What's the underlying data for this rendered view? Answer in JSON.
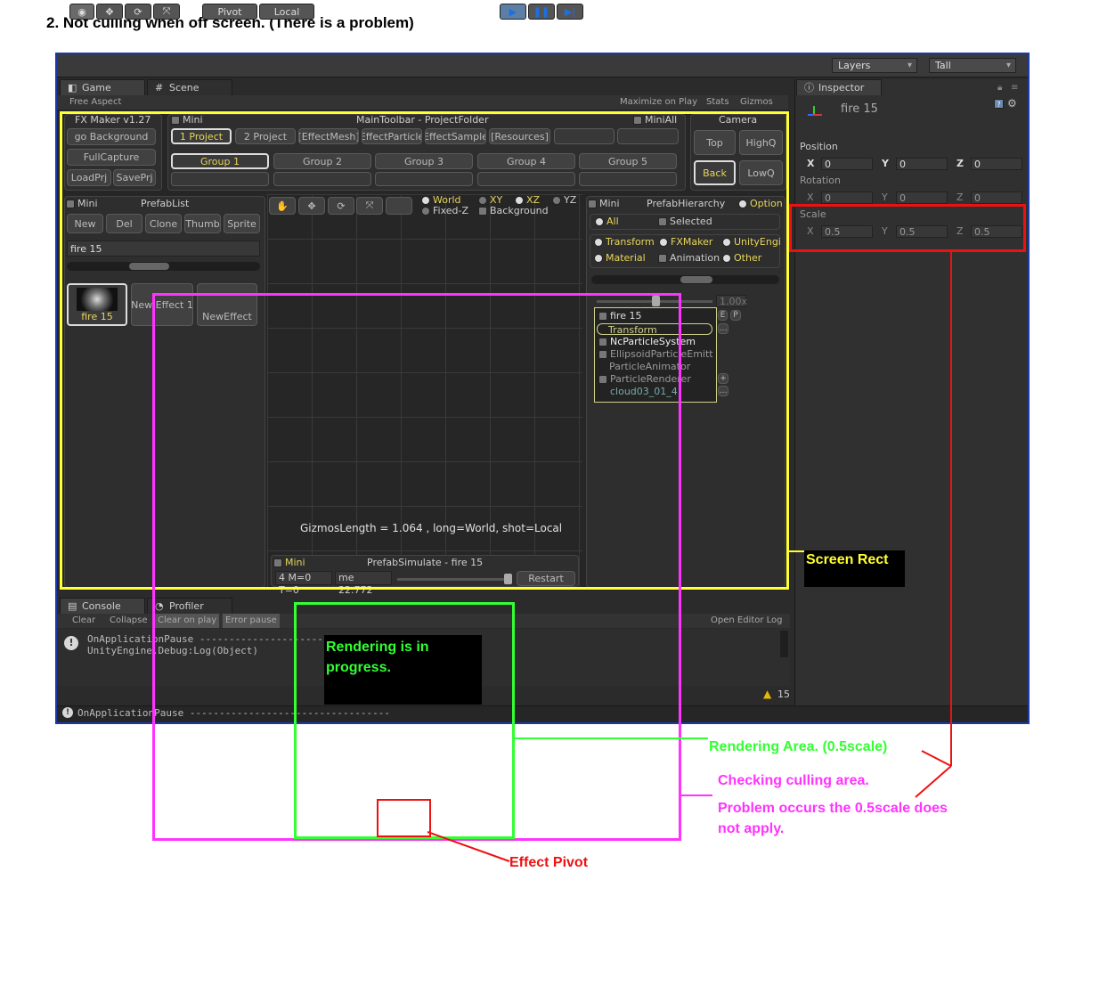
{
  "heading": "2. Not culling when off screen. (There is a problem)",
  "toolbar": {
    "pivot": "Pivot",
    "local": "Local",
    "layers": "Layers",
    "layout": "Tall"
  },
  "game_tab": {
    "game": "Game",
    "scene": "Scene",
    "aspect": "Free Aspect",
    "maximize": "Maximize on Play",
    "stats": "Stats",
    "gizmos": "Gizmos"
  },
  "fxmaker": {
    "version": "FX Maker v1.27",
    "go_background": "go Background",
    "full_capture": "FullCapture",
    "load_prj": "LoadPrj",
    "save_prj": "SavePrj",
    "mini": "Mini",
    "main_toolbar": "MainToolbar - ProjectFolder",
    "mini_all": "MiniAll",
    "projects": [
      "1 Project",
      "2 Project",
      "[EffectMesh]",
      "EffectParticle",
      "EffectSample",
      "[Resources]"
    ],
    "groups": [
      "Group 1",
      "Group 2",
      "Group 3",
      "Group 4",
      "Group 5"
    ],
    "camera": "Camera",
    "cam_top": "Top",
    "cam_highq": "HighQ",
    "cam_back": "Back",
    "cam_lowq": "LowQ"
  },
  "prefab_list": {
    "mini": "Mini",
    "title": "PrefabList",
    "buttons": [
      "New",
      "Del",
      "Clone",
      "Thumb",
      "Sprite"
    ],
    "search": "fire 15",
    "items": [
      "fire 15",
      "New Effect 1",
      "NewEffect"
    ]
  },
  "scene_tools": {
    "world": "World",
    "fixed_z": "Fixed-Z",
    "xy": "XY",
    "xz": "XZ",
    "yz": "YZ",
    "background": "Background",
    "gizmos_info": "GizmosLength = 1.064 , long=World, shot=Local"
  },
  "prefab_simulate": {
    "mini": "Mini",
    "title": "PrefabSimulate - fire 15",
    "stats": "4 M=0 T=0",
    "time": "me 22.772",
    "restart": "Restart"
  },
  "hierarchy": {
    "mini": "Mini",
    "title": "PrefabHierarchy",
    "option": "Option",
    "all": "All",
    "selected": "Selected",
    "filters": [
      "Transform",
      "FXMaker",
      "UnityEngi",
      "Material",
      "Animation",
      "Other"
    ],
    "speed": "1.00x",
    "nodes": [
      "fire 15",
      "Transform",
      "NcParticleSystem",
      "EllipsoidParticleEmitt",
      "ParticleAnimator",
      "ParticleRenderer",
      "cloud03_01_4"
    ]
  },
  "inspector": {
    "tab": "Inspector",
    "object": "fire 15",
    "position": "Position",
    "rotation": "Rotation",
    "scale": "Scale",
    "axes": [
      "X",
      "Y",
      "Z"
    ],
    "position_values": [
      "0",
      "0",
      "0"
    ],
    "rotation_values": [
      "0",
      "0",
      "0"
    ],
    "scale_values": [
      "0.5",
      "0.5",
      "0.5"
    ]
  },
  "console": {
    "tab": "Console",
    "profiler": "Profiler",
    "buttons": [
      "Clear",
      "Collapse",
      "Clear on play",
      "Error pause"
    ],
    "open_log": "Open Editor Log",
    "line1": "OnApplicationPause ----------------------------------",
    "line2": "UnityEngine.Debug:Log(Object)",
    "warn_count": "15",
    "status": "OnApplicationPause ----------------------------------"
  },
  "annotations": {
    "screen_rect": "Screen Rect",
    "rendering_progress": "Rendering is in progress.",
    "rendering_area": "Rendering Area.  (0.5scale)",
    "checking_area": "Checking culling area.",
    "problem": "Problem occurs the 0.5scale does not apply.",
    "effect_pivot": "Effect Pivot"
  },
  "colors": {
    "screen_rect": "#ffff33",
    "rendering": "#33ff33",
    "culling": "#ff33ff",
    "pivot": "#ee1111",
    "editor_bg": "#2b2b2b"
  }
}
